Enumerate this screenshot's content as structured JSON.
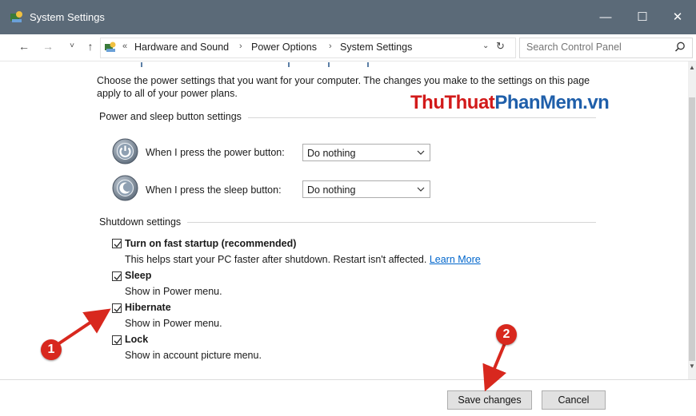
{
  "window": {
    "title": "System Settings",
    "buttons": {
      "minimize": "—",
      "maximize": "☐",
      "close": "✕"
    },
    "titlebar_color": "#5b6a78"
  },
  "address_bar": {
    "back": "←",
    "forward": "→",
    "recent": "˅",
    "up": "↑",
    "overflow": "«",
    "breadcrumbs": [
      "Hardware and Sound",
      "Power Options",
      "System Settings"
    ],
    "separator": "›",
    "dropdown": "⌄",
    "refresh": "↻",
    "search_placeholder": "Search Control Panel"
  },
  "intro_text": "Choose the power settings that you want for your computer. The changes you make to the settings on this page apply to all of your power plans.",
  "watermark": {
    "part1": "ThuThuat",
    "part2": "PhanMem.vn"
  },
  "power_section": {
    "title": "Power and sleep button settings",
    "rows": [
      {
        "label": "When I press the power button:",
        "value": "Do nothing",
        "icon": "power-button-icon"
      },
      {
        "label": "When I press the sleep button:",
        "value": "Do nothing",
        "icon": "sleep-button-icon"
      }
    ]
  },
  "shutdown_section": {
    "title": "Shutdown settings",
    "options": [
      {
        "label": "Turn on fast startup (recommended)",
        "desc": "This helps start your PC faster after shutdown. Restart isn't affected. ",
        "link": "Learn More",
        "checked": true
      },
      {
        "label": "Sleep",
        "desc": "Show in Power menu.",
        "checked": true
      },
      {
        "label": "Hibernate",
        "desc": "Show in Power menu.",
        "checked": true
      },
      {
        "label": "Lock",
        "desc": "Show in account picture menu.",
        "checked": true
      }
    ]
  },
  "footer": {
    "save": "Save changes",
    "cancel": "Cancel"
  },
  "annotations": {
    "badge1": "1",
    "badge2": "2",
    "color": "#d8281e"
  }
}
